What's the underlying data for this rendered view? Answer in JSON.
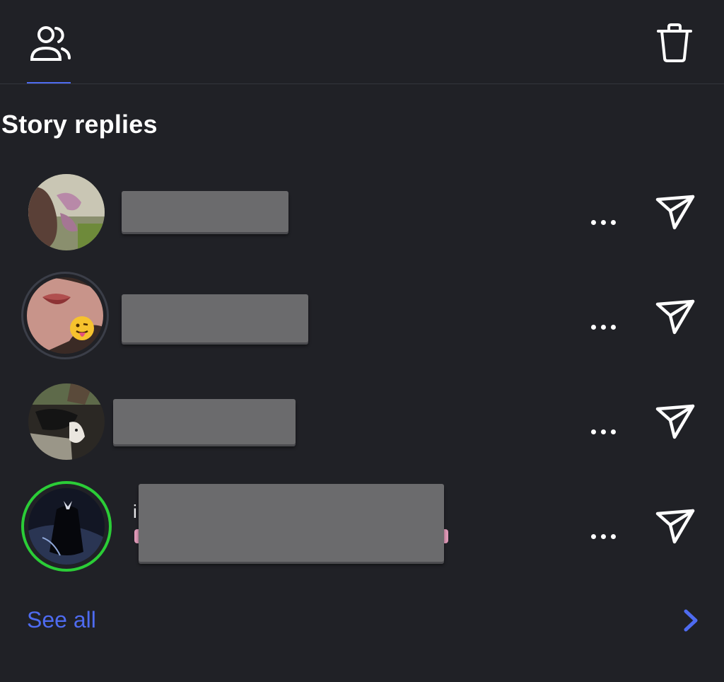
{
  "header": {
    "tabs": [
      {
        "icon": "people-icon",
        "active": true
      }
    ],
    "actions": [
      {
        "icon": "trash-icon"
      }
    ]
  },
  "section": {
    "title": "Story replies"
  },
  "rows": [
    {
      "avatar": "butterfly-photo",
      "name": "",
      "sub": "",
      "ring": "none"
    },
    {
      "avatar": "lips-emoji-photo",
      "name": "",
      "sub": "",
      "ring": "grey"
    },
    {
      "avatar": "pets-photo",
      "name": "",
      "sub": "",
      "ring": "none"
    },
    {
      "avatar": "dark-figure-photo",
      "name": "i",
      "sub": "",
      "ring": "green"
    }
  ],
  "more_label": "...",
  "footer": {
    "see_all": "See all",
    "chevron": "chevron-right-icon"
  },
  "colors": {
    "background": "#202126",
    "accent": "#4e6bf0",
    "online_ring": "#2bcd37",
    "redaction": "#6b6b6d"
  }
}
